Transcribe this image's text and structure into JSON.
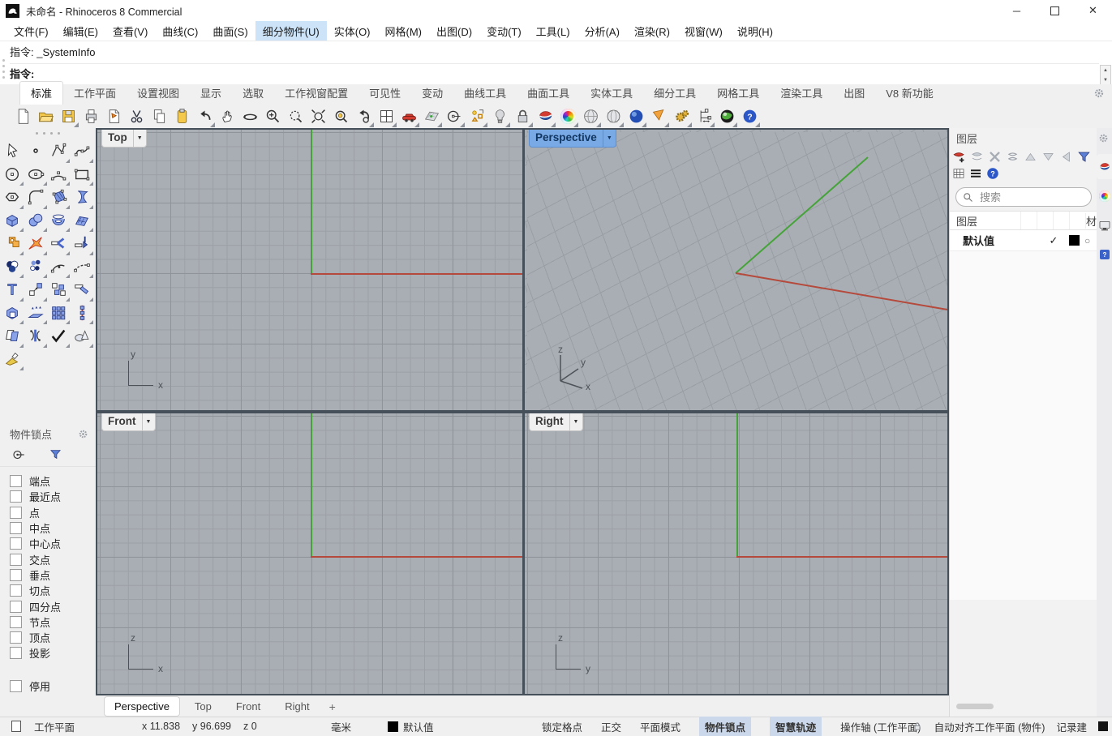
{
  "title_bar": {
    "title": "未命名 - Rhinoceros 8 Commercial"
  },
  "menu": {
    "items": [
      {
        "label": "文件(F)"
      },
      {
        "label": "编辑(E)"
      },
      {
        "label": "查看(V)"
      },
      {
        "label": "曲线(C)"
      },
      {
        "label": "曲面(S)"
      },
      {
        "label": "细分物件(U)",
        "highlighted": true
      },
      {
        "label": "实体(O)"
      },
      {
        "label": "网格(M)"
      },
      {
        "label": "出图(D)"
      },
      {
        "label": "变动(T)"
      },
      {
        "label": "工具(L)"
      },
      {
        "label": "分析(A)"
      },
      {
        "label": "渲染(R)"
      },
      {
        "label": "视窗(W)"
      },
      {
        "label": "说明(H)"
      }
    ]
  },
  "command": {
    "history": "指令: _SystemInfo",
    "prompt": "指令:"
  },
  "toolbar_tabs": {
    "items": [
      {
        "label": "标准",
        "active": true
      },
      {
        "label": "工作平面"
      },
      {
        "label": "设置视图"
      },
      {
        "label": "显示"
      },
      {
        "label": "选取"
      },
      {
        "label": "工作视窗配置"
      },
      {
        "label": "可见性"
      },
      {
        "label": "变动"
      },
      {
        "label": "曲线工具"
      },
      {
        "label": "曲面工具"
      },
      {
        "label": "实体工具"
      },
      {
        "label": "细分工具"
      },
      {
        "label": "网格工具"
      },
      {
        "label": "渲染工具"
      },
      {
        "label": "出图"
      },
      {
        "label": "V8 新功能"
      }
    ]
  },
  "toolbar_icons": [
    {
      "name": "new-file"
    },
    {
      "name": "open-file"
    },
    {
      "name": "save",
      "flyout": true
    },
    {
      "name": "print"
    },
    {
      "name": "export-doc"
    },
    {
      "name": "cut"
    },
    {
      "name": "copy"
    },
    {
      "name": "paste"
    },
    {
      "name": "undo",
      "flyout": true
    },
    {
      "name": "pan-view"
    },
    {
      "name": "rotate-view"
    },
    {
      "name": "zoom-dynamic"
    },
    {
      "name": "zoom-window"
    },
    {
      "name": "zoom-extents"
    },
    {
      "name": "zoom-selected"
    },
    {
      "name": "undo-view-change",
      "flyout": true
    },
    {
      "name": "viewport-layout",
      "flyout": true
    },
    {
      "name": "named-views",
      "flyout": true
    },
    {
      "name": "set-cplane",
      "flyout": true
    },
    {
      "name": "circle-center",
      "flyout": true
    },
    {
      "name": "selection-filter",
      "flyout": true
    },
    {
      "name": "spotlight-lamp",
      "flyout": true
    },
    {
      "name": "lock-objects",
      "flyout": true
    },
    {
      "name": "object-properties",
      "flyout": true
    },
    {
      "name": "color-wheel",
      "flyout": true
    },
    {
      "name": "shaded-viewport",
      "flyout": true
    },
    {
      "name": "ghosted-viewport",
      "flyout": true
    },
    {
      "name": "rendered-viewport",
      "flyout": true
    },
    {
      "name": "display-cone",
      "flyout": true
    },
    {
      "name": "options-gears",
      "flyout": true
    },
    {
      "name": "measure-dimension",
      "flyout": true
    },
    {
      "name": "render-globe",
      "flyout": true
    },
    {
      "name": "help",
      "flyout": true
    }
  ],
  "tool_palette": [
    {
      "name": "select-cursor"
    },
    {
      "name": "single-point"
    },
    {
      "name": "curve-control-points",
      "flyout": true
    },
    {
      "name": "curve-freeform",
      "flyout": true
    },
    {
      "name": "circle-tool",
      "flyout": true
    },
    {
      "name": "ellipse-tool",
      "flyout": true
    },
    {
      "name": "arc-tool",
      "flyout": true
    },
    {
      "name": "rectangle-tool",
      "flyout": true
    },
    {
      "name": "polygon-tool",
      "flyout": true
    },
    {
      "name": "fillet-curve",
      "flyout": true
    },
    {
      "name": "surface-from-points",
      "flyout": true
    },
    {
      "name": "surface-bend",
      "flyout": true
    },
    {
      "name": "box-tool",
      "flyout": true
    },
    {
      "name": "sphere-tool",
      "flyout": true
    },
    {
      "name": "loft-tool",
      "flyout": true
    },
    {
      "name": "patch-tool",
      "flyout": true
    },
    {
      "name": "explode-puzzle",
      "flyout": true
    },
    {
      "name": "explode-burst",
      "flyout": true
    },
    {
      "name": "trim-tool",
      "flyout": true
    },
    {
      "name": "split-tool",
      "flyout": true
    },
    {
      "name": "boolean-tool",
      "flyout": true
    },
    {
      "name": "point-cloud-tool",
      "flyout": true
    },
    {
      "name": "adjust-curve",
      "flyout": true
    },
    {
      "name": "blend-curve",
      "flyout": true
    },
    {
      "name": "text-tool",
      "flyout": true
    },
    {
      "name": "move-tool",
      "flyout": true
    },
    {
      "name": "copy-tool",
      "flyout": true
    },
    {
      "name": "rotate-tool",
      "flyout": true
    },
    {
      "name": "solid-union",
      "flyout": true
    },
    {
      "name": "extrude-tool",
      "flyout": true
    },
    {
      "name": "array-tool",
      "flyout": true
    },
    {
      "name": "linear-array-tool",
      "flyout": true
    },
    {
      "name": "layer-tools",
      "flyout": true
    },
    {
      "name": "orient-tool",
      "flyout": true
    },
    {
      "name": "check-tool",
      "flyout": true
    },
    {
      "name": "group-tool",
      "flyout": true
    },
    {
      "name": "paint-tool",
      "flyout": true
    }
  ],
  "osnap": {
    "title": "物件锁点",
    "items": [
      "端点",
      "最近点",
      "点",
      "中点",
      "中心点",
      "交点",
      "垂点",
      "切点",
      "四分点",
      "节点",
      "顶点",
      "投影"
    ],
    "disable_label": "停用"
  },
  "viewports": {
    "top": {
      "label": "Top",
      "axis_h": "x",
      "axis_v": "y"
    },
    "perspective": {
      "label": "Perspective",
      "active": true,
      "axis_h": "x",
      "axis_mid": "y",
      "axis_v": "z"
    },
    "front": {
      "label": "Front",
      "axis_h": "x",
      "axis_v": "z"
    },
    "right": {
      "label": "Right",
      "axis_h": "y",
      "axis_v": "z"
    },
    "colors": {
      "background": "#a9aeb4",
      "grid": "#9ba0a6",
      "grid_major": "#8f949b",
      "x_axis": "#b54a3c",
      "y_axis": "#46a33a"
    }
  },
  "viewport_tabs": {
    "items": [
      {
        "label": "Perspective",
        "active": true
      },
      {
        "label": "Top"
      },
      {
        "label": "Front"
      },
      {
        "label": "Right"
      }
    ],
    "add_label": "+"
  },
  "layers_panel": {
    "title": "图层",
    "toolbar": [
      "new-layer",
      "new-sublayer",
      "delete-layer",
      "duplicate-layer",
      "move-up",
      "move-down",
      "move-left",
      "filter-funnel"
    ],
    "toolbar2": [
      "table-view",
      "menu-lines",
      "panel-help"
    ],
    "search_placeholder": "搜索",
    "columns": {
      "name": "图层",
      "material": "材"
    },
    "rows": [
      {
        "name": "默认值",
        "current": true,
        "check": "✓",
        "color": "#000000",
        "material_symbol": "○"
      }
    ]
  },
  "side_tabs": [
    "properties-tab",
    "materials-tab",
    "display-tab",
    "help-tab"
  ],
  "status_bar": {
    "cplane_label": "工作平面",
    "coords": [
      "x 11.838",
      "y 96.699",
      "z 0"
    ],
    "units": "毫米",
    "layer": {
      "name": "默认值",
      "color": "#000000"
    },
    "toggles": [
      {
        "label": "锁定格点"
      },
      {
        "label": "正交"
      },
      {
        "label": "平面模式"
      },
      {
        "label": "物件锁点",
        "active": true
      },
      {
        "label": "智慧轨迹",
        "active": true
      },
      {
        "label": "操作轴 (工作平面)"
      }
    ],
    "right_items": [
      {
        "label": "自动对齐工作平面 (物件)"
      },
      {
        "label": "记录建"
      }
    ]
  }
}
